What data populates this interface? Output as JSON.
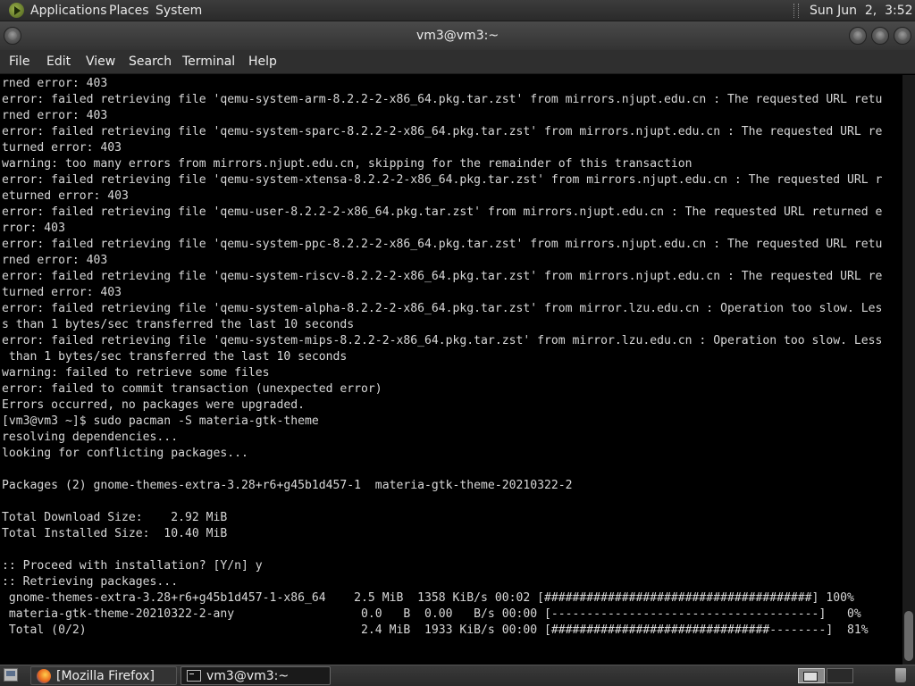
{
  "top_panel": {
    "applications": "Applications",
    "places": "Places",
    "system": "System",
    "clock": "Sun Jun  2,  3:52 AM"
  },
  "window": {
    "title": "vm3@vm3:~"
  },
  "menubar": {
    "file": "File",
    "edit": "Edit",
    "view": "View",
    "search": "Search",
    "terminal": "Terminal",
    "help": "Help"
  },
  "terminal": {
    "lines": [
      "rned error: 403",
      "error: failed retrieving file 'qemu-system-arm-8.2.2-2-x86_64.pkg.tar.zst' from mirrors.njupt.edu.cn : The requested URL retu",
      "rned error: 403",
      "error: failed retrieving file 'qemu-system-sparc-8.2.2-2-x86_64.pkg.tar.zst' from mirrors.njupt.edu.cn : The requested URL re",
      "turned error: 403",
      "warning: too many errors from mirrors.njupt.edu.cn, skipping for the remainder of this transaction",
      "error: failed retrieving file 'qemu-system-xtensa-8.2.2-2-x86_64.pkg.tar.zst' from mirrors.njupt.edu.cn : The requested URL r",
      "eturned error: 403",
      "error: failed retrieving file 'qemu-user-8.2.2-2-x86_64.pkg.tar.zst' from mirrors.njupt.edu.cn : The requested URL returned e",
      "rror: 403",
      "error: failed retrieving file 'qemu-system-ppc-8.2.2-2-x86_64.pkg.tar.zst' from mirrors.njupt.edu.cn : The requested URL retu",
      "rned error: 403",
      "error: failed retrieving file 'qemu-system-riscv-8.2.2-2-x86_64.pkg.tar.zst' from mirrors.njupt.edu.cn : The requested URL re",
      "turned error: 403",
      "error: failed retrieving file 'qemu-system-alpha-8.2.2-2-x86_64.pkg.tar.zst' from mirror.lzu.edu.cn : Operation too slow. Les",
      "s than 1 bytes/sec transferred the last 10 seconds",
      "error: failed retrieving file 'qemu-system-mips-8.2.2-2-x86_64.pkg.tar.zst' from mirror.lzu.edu.cn : Operation too slow. Less",
      " than 1 bytes/sec transferred the last 10 seconds",
      "warning: failed to retrieve some files",
      "error: failed to commit transaction (unexpected error)",
      "Errors occurred, no packages were upgraded.",
      "[vm3@vm3 ~]$ sudo pacman -S materia-gtk-theme",
      "resolving dependencies...",
      "looking for conflicting packages...",
      "",
      "Packages (2) gnome-themes-extra-3.28+r6+g45b1d457-1  materia-gtk-theme-20210322-2",
      "",
      "Total Download Size:    2.92 MiB",
      "Total Installed Size:  10.40 MiB",
      "",
      ":: Proceed with installation? [Y/n] y",
      ":: Retrieving packages...",
      " gnome-themes-extra-3.28+r6+g45b1d457-1-x86_64    2.5 MiB  1358 KiB/s 00:02 [######################################] 100%",
      " materia-gtk-theme-20210322-2-any                  0.0   B  0.00   B/s 00:00 [--------------------------------------]   0%",
      " Total (0/2)                                       2.4 MiB  1933 KiB/s 00:00 [###############################--------]  81%"
    ]
  },
  "taskbar": {
    "firefox_task": "[Mozilla Firefox]",
    "terminal_task": "vm3@vm3:~"
  }
}
